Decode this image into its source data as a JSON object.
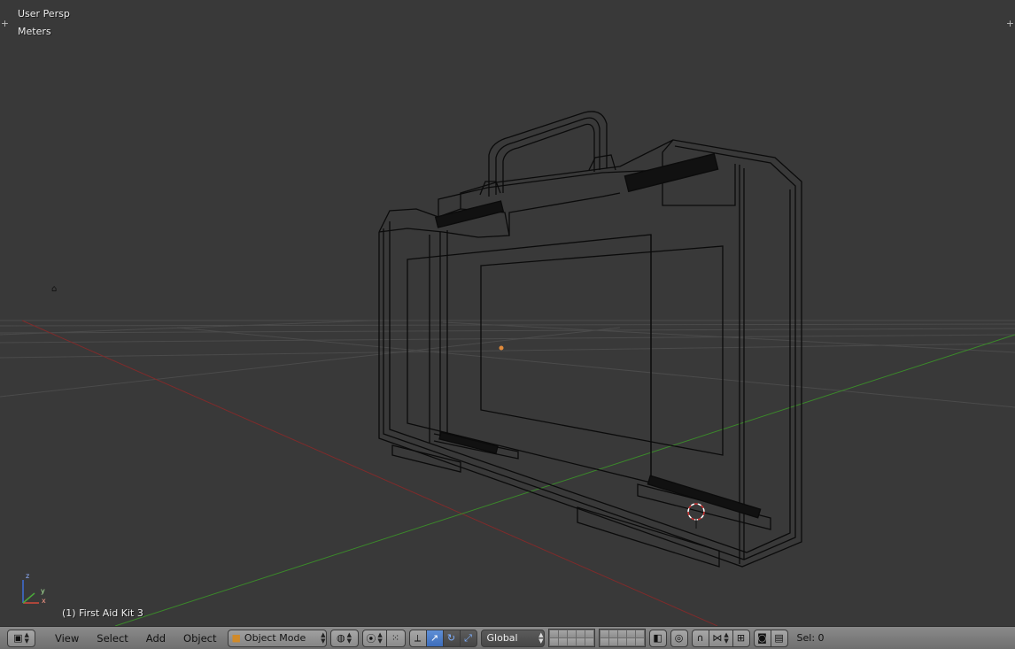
{
  "viewport": {
    "view_name": "User Persp",
    "units": "Meters",
    "object_info": "(1) First Aid Kit 3",
    "axis_labels": {
      "x": "x",
      "y": "y",
      "z": "z"
    },
    "colors": {
      "background": "#393939",
      "grid": "#4a4a4a",
      "x_axis": "#8a2e2e",
      "y_axis": "#3f8a2e",
      "wire": "#000000",
      "origin": "#e08a3a"
    }
  },
  "header": {
    "editor_type_icon": "cube-icon",
    "menus": [
      "View",
      "Select",
      "Add",
      "Object"
    ],
    "mode": "Object Mode",
    "mode_icon": "object-mode-icon",
    "shading_icon": "sphere-wire-icon",
    "pivot_icon": "pivot-icon",
    "manipulator_icons": [
      "manipulator-toggle-icon",
      "translate-icon",
      "rotate-icon",
      "scale-icon"
    ],
    "orientation": "Global",
    "snap_icons": [
      "lock-camera-icon",
      "proportional-icon",
      "snap-magnet-icon",
      "snap-element-icon",
      "snap-target-icon"
    ],
    "render_icons": [
      "render-still-icon",
      "render-animation-icon"
    ],
    "selection_count": "Sel: 0"
  }
}
